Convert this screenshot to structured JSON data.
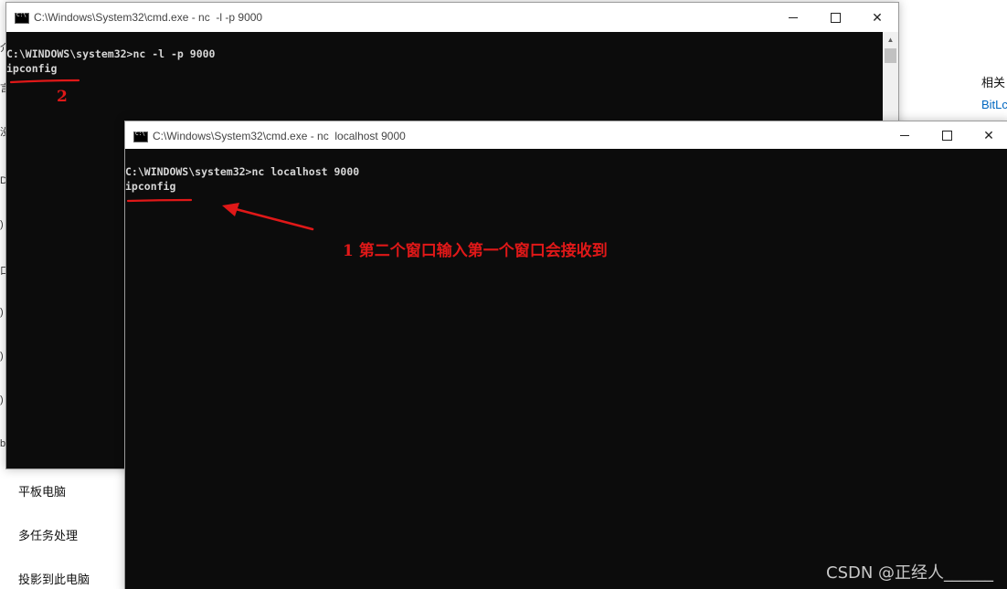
{
  "background_settings": {
    "sidebar_items": [
      "平板电脑",
      "多任务处理",
      "投影到此电脑"
    ],
    "right_panel": {
      "heading": "相关",
      "link": "BitLc"
    },
    "edge_glyphs": [
      "介",
      "言",
      "没",
      "D",
      ")",
      "口",
      ")",
      ")",
      ")",
      "b",
      "?"
    ]
  },
  "window_back": {
    "title": "C:\\Windows\\System32\\cmd.exe - nc  -l -p 9000",
    "lines": [
      "C:\\WINDOWS\\system32>nc -l -p 9000",
      "ipconfig"
    ]
  },
  "window_front": {
    "title": "C:\\Windows\\System32\\cmd.exe - nc  localhost 9000",
    "lines": [
      "C:\\WINDOWS\\system32>nc localhost 9000",
      "ipconfig"
    ]
  },
  "annotations": {
    "label_2": "2",
    "label_1": "1 第二个窗口输入第一个窗口会接收到",
    "color": "#e01818"
  },
  "watermark": "CSDN @正经人______"
}
